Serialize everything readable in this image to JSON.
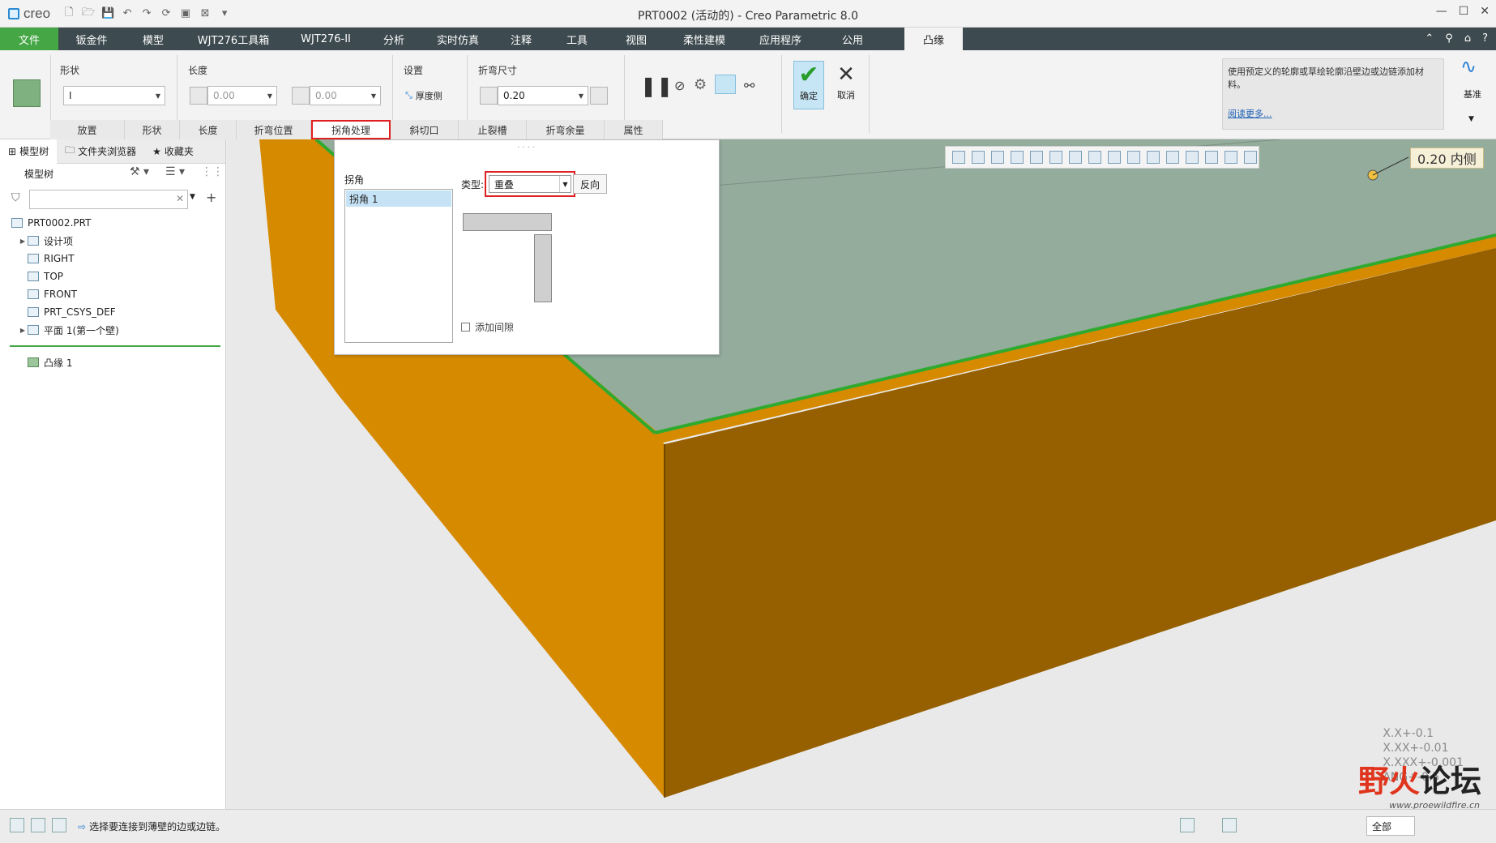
{
  "window": {
    "app_logo": "creo",
    "title": "PRT0002 (活动的) - Creo Parametric 8.0"
  },
  "menu": {
    "tabs": [
      {
        "label": "文件",
        "w": 72
      },
      {
        "label": "钣金件",
        "w": 82
      },
      {
        "label": "模型",
        "w": 70
      },
      {
        "label": "WJT276工具箱",
        "w": 128
      },
      {
        "label": "WJT276-II",
        "w": 100
      },
      {
        "label": "分析",
        "w": 68
      },
      {
        "label": "实时仿真",
        "w": 90
      },
      {
        "label": "注释",
        "w": 66
      },
      {
        "label": "工具",
        "w": 72
      },
      {
        "label": "视图",
        "w": 74
      },
      {
        "label": "柔性建模",
        "w": 94
      },
      {
        "label": "应用程序",
        "w": 94
      },
      {
        "label": "公用",
        "w": 84
      },
      {
        "label": "凸缘",
        "w": 72
      }
    ]
  },
  "ribbon": {
    "shape_label": "形状",
    "shape_value": "I",
    "length_label": "长度",
    "length_value_1": "0.00",
    "length_value_2": "0.00",
    "settings_label": "设置",
    "thickness_side": "厚度侧",
    "bend_dim_label": "折弯尺寸",
    "bend_dim_value": "0.20",
    "ok_label": "确定",
    "cancel_label": "取消",
    "help_text": "使用预定义的轮廓或草绘轮廓沿壁边或边链添加材料。",
    "help_link": "阅读更多...",
    "datum_label": "基准",
    "subtabs": [
      {
        "label": "放置",
        "w": 92
      },
      {
        "label": "形状",
        "w": 68
      },
      {
        "label": "长度",
        "w": 70
      },
      {
        "label": "折弯位置",
        "w": 92
      },
      {
        "label": "拐角处理",
        "w": 98
      },
      {
        "label": "斜切口",
        "w": 84
      },
      {
        "label": "止裂槽",
        "w": 84
      },
      {
        "label": "折弯余量",
        "w": 96
      },
      {
        "label": "属性",
        "w": 72
      }
    ]
  },
  "left_panel": {
    "tabs": [
      "模型树",
      "文件夹浏览器",
      "收藏夹"
    ],
    "tree_title": "模型树",
    "tree": [
      {
        "label": "PRT0002.PRT",
        "indent": 14
      },
      {
        "label": "设计项",
        "indent": 34,
        "expand": true
      },
      {
        "label": "RIGHT",
        "indent": 34
      },
      {
        "label": "TOP",
        "indent": 34
      },
      {
        "label": "FRONT",
        "indent": 34
      },
      {
        "label": "PRT_CSYS_DEF",
        "indent": 34
      },
      {
        "label": "平面 1(第一个壁)",
        "indent": 34,
        "expand": true
      }
    ],
    "insert_item": "凸缘 1"
  },
  "corner_panel": {
    "corner_label": "拐角",
    "corner_item": "拐角 1",
    "type_label": "类型:",
    "type_value": "重叠",
    "reverse_button": "反向",
    "add_gap": "添加间隙"
  },
  "graphics": {
    "dim_label": "0.20 内侧",
    "tolerance": [
      "X.X+-0.1",
      "X.XX+-0.01",
      "X.XXX+-0.001",
      "ANG+-0.5"
    ],
    "watermark_a": "野火",
    "watermark_b": "论坛",
    "watermark_url": "www.proewildfire.cn"
  },
  "status": {
    "message": "选择要连接到薄壁的边或边链。",
    "filter_value": "全部"
  },
  "colors": {
    "menubar": "#3d4a4f",
    "accent_green": "#44a644",
    "part_orange": "#d68a00",
    "part_dark": "#965f00",
    "sheet_face": "#93ac9c",
    "highlight_red": "#e02020"
  }
}
